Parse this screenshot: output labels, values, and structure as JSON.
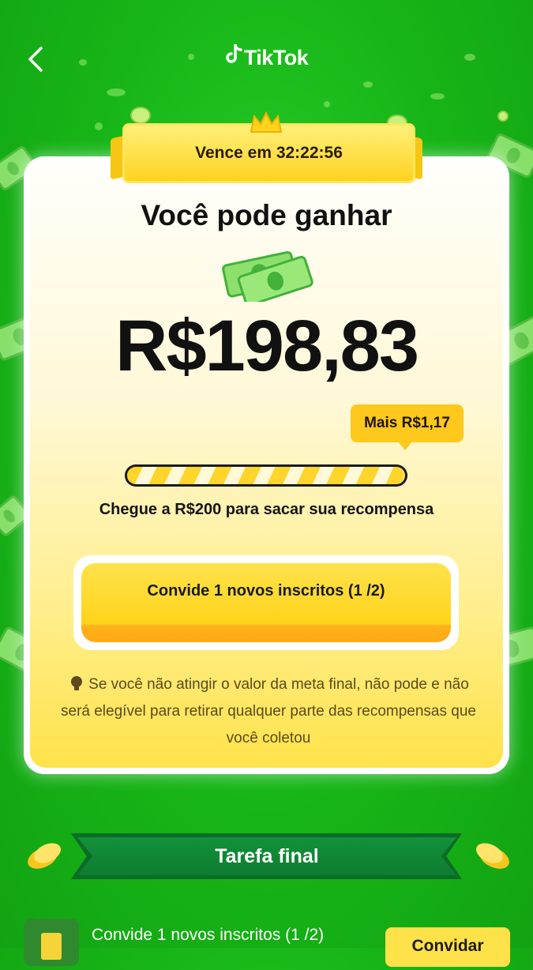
{
  "header": {
    "brand": "TikTok"
  },
  "card": {
    "countdown_label": "Vence em 32:22:56",
    "title": "Você pode ganhar",
    "amount": "R$198,83",
    "tooltip": "Mais R$1,17",
    "progress_fraction": 0.994,
    "goal_text": "Chegue a R$200 para sacar sua recompensa",
    "cta_label": "Convide 1 novos inscritos (1 /2)",
    "notice": "Se você não atingir o valor da meta final, não pode e não será elegível para retirar qualquer parte das recompensas que você coletou"
  },
  "final_task": {
    "banner": "Tarefa final",
    "task_label": "Convide 1 novos inscritos (1 /2)",
    "invite_button": "Convidar"
  },
  "colors": {
    "background": "#17b417",
    "accent_yellow": "#ffd31a",
    "banner_green": "#0e7d31"
  }
}
